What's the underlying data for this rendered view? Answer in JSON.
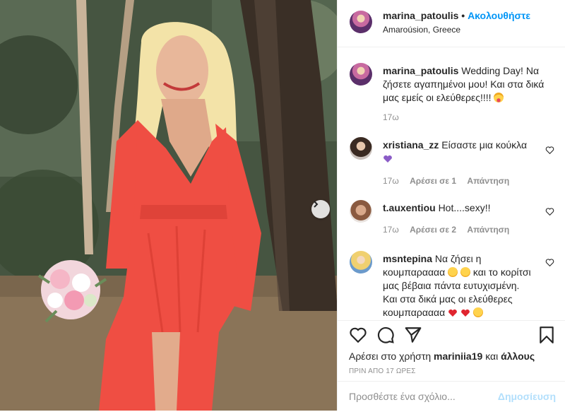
{
  "header": {
    "username": "marina_patoulis",
    "dot": "•",
    "follow_label": "Ακολουθήστε",
    "location": "Amaroúsion, Greece"
  },
  "caption": {
    "username": "marina_patoulis",
    "text": "Wedding Day! Να ζήσετε αγαπημένοι μου! Και στα δικά μας εμείς οι ελεύθερες!!!!",
    "emoji": "face-with-tongue",
    "time": "17ω"
  },
  "comments": [
    {
      "username": "xristiana_zz",
      "text": "Είσαστε μια κούκλα",
      "emoji": "purple-heart",
      "time": "17ω",
      "likes": "Αρέσει σε 1",
      "reply": "Απάντηση"
    },
    {
      "username": "t.auxentiou",
      "text": "Hot....sexy!!",
      "time": "17ω",
      "likes": "Αρέσει σε 2",
      "reply": "Απάντηση"
    },
    {
      "username": "msntepina",
      "text_1": "Να ζήσει η κουμπαραααα",
      "text_2": "και το κορίτσι μας βέβαια πάντα ευτυχισμένη. Και στα δικά μας οι ελεύθερες κουμπαραααα",
      "emojis": [
        "kissing-face",
        "smiling-face",
        "red-heart",
        "red-heart",
        "smiling-face"
      ]
    }
  ],
  "actions": {
    "likes_prefix": "Αρέσει στο χρήστη",
    "likes_user": "mariniia19",
    "likes_and": "και",
    "likes_others": "άλλους",
    "post_time": "ΠΡΙΝ ΑΠΟ 17 ΩΡΕΣ"
  },
  "add_comment": {
    "placeholder": "Προσθέστε ένα σχόλιο...",
    "post_label": "Δημοσίευση"
  },
  "colors": {
    "link_blue": "#0095f6",
    "post_disabled": "#b2dffc",
    "muted": "#8e8e8e",
    "dress": "#ef4e43"
  },
  "icons": [
    "heart-icon",
    "comment-icon",
    "share-icon",
    "bookmark-icon",
    "chevron-right-icon"
  ]
}
